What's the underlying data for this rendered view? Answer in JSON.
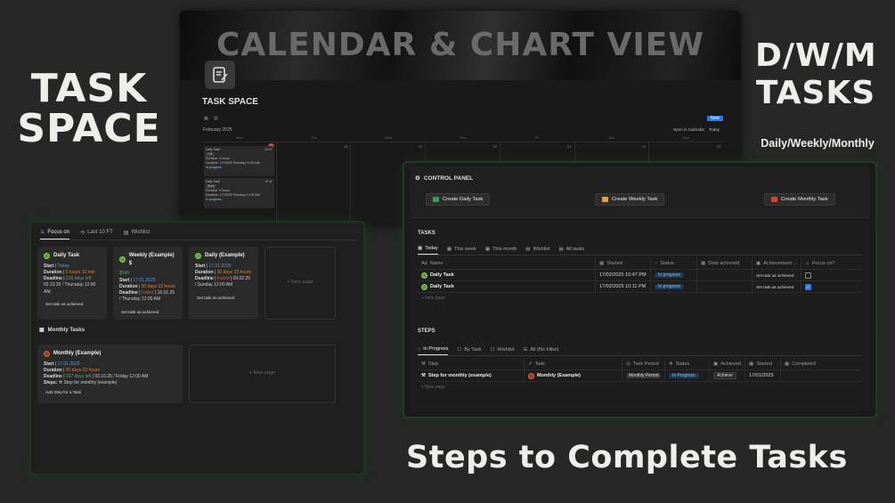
{
  "headlines": {
    "task_space": "TASK SPACE",
    "dwm": "D/W/M TASKS",
    "dwm_sub": "Daily/Weekly/Monthly",
    "steps": "Steps to Complete Tasks"
  },
  "calendar": {
    "cover_title": "CALENDAR & CHART VIEW",
    "page_title": "TASK SPACE",
    "month": "February 2025",
    "open_in_calendar": "Open in Calendar",
    "today_btn": "Today",
    "new_btn": "New",
    "weekdays": [
      "Mon",
      "Tue",
      "Wed",
      "Thu",
      "Fri",
      "Sat",
      "Sun"
    ],
    "days": [
      "17",
      "18",
      "19",
      "20",
      "21",
      "22",
      "23"
    ],
    "cards": [
      {
        "title": "Daily Task",
        "time": "10:47",
        "tag": "Life",
        "duration": "Duration: 9 hours",
        "deadline": "Deadline: 17/02/25 Thursday 12:00 AM",
        "status": "In progress"
      },
      {
        "title": "Daily Task",
        "time": "10:11",
        "tag": "Work",
        "duration": "Duration: 9 hours",
        "deadline": "Deadline: 17/02/25 Thursday 12:00 AM",
        "status": "In progress"
      }
    ]
  },
  "focus": {
    "tabs": [
      "Focus on",
      "Last 10 FT",
      "Wishlist"
    ],
    "cards": [
      {
        "title": "Daily Task",
        "price": "",
        "start_label": "Start",
        "start": "Today",
        "duration_label": "Duration",
        "duration": "9 hours 10 min",
        "deadline_label": "Deadline",
        "deadline_left": "226 days left",
        "deadline_date": "02.10.25 / Thursday 12:00 AM",
        "action": "Set task as achieved"
      },
      {
        "title": "Weekly (Example) $",
        "price": "$545",
        "start_label": "Start",
        "start": "17.01.2025",
        "duration_label": "Duration",
        "duration": "30 days 23 hours",
        "deadline_label": "Deadline",
        "deadline_left": "Failed",
        "deadline_date": "16.01.25 / Thursday 12:00 AM",
        "action": "Set task as achieved"
      },
      {
        "title": "Daily (Example)",
        "price": "",
        "start_label": "Start",
        "start": "17.01.2025",
        "duration_label": "Duration",
        "duration": "30 days 23 hours",
        "deadline_label": "Deadline",
        "deadline_left": "Failed",
        "deadline_date": "09.02.25 / Sunday 12:00 AM",
        "action": "Set task as achieved"
      }
    ],
    "new_page": "+ New page",
    "monthly_heading": "Monthly Tasks",
    "monthly_card": {
      "title": "Monthly (Example)",
      "start_label": "Start",
      "start": "17.01.2025",
      "duration_label": "Duration",
      "duration": "30 days 23 hours",
      "deadline_label": "Deadline",
      "deadline_left": "227 days left",
      "deadline_date": "03.10.25 / Friday 12:00 AM",
      "steps_label": "Steps:",
      "steps": "Step for monthly (example)",
      "action": "Add Step for a Task"
    }
  },
  "control": {
    "title": "CONTROL PANEL",
    "buttons": [
      "Create Daily Task",
      "Create Weekly Task",
      "Create Monthly Task"
    ],
    "button_colors": [
      "#3f9b4f",
      "#d9a23a",
      "#c9453d"
    ],
    "tasks_title": "TASKS",
    "tasks_tabs": [
      "Today",
      "This week",
      "This month",
      "Wishlist",
      "All tasks"
    ],
    "tasks_columns": [
      "Name",
      "Started",
      "Status",
      "Date achieved",
      "Achievement ...",
      "Focus on?"
    ],
    "tasks_rows": [
      {
        "name": "Daily Task",
        "started": "17/02/2025 10:47 PM",
        "status": "In progress",
        "achieved": "",
        "action": "Set task as achieved",
        "focus": false
      },
      {
        "name": "Daily Task",
        "started": "17/02/2025 10:11 PM",
        "status": "In progress",
        "achieved": "",
        "action": "Set task as achieved",
        "focus": true
      }
    ],
    "new_page": "+ New page",
    "steps_title": "STEPS",
    "steps_tabs": [
      "In Progress",
      "By Task",
      "Wishlist",
      "All (No Filter)"
    ],
    "steps_columns": [
      "Step",
      "Task",
      "Task Period",
      "Status",
      "Achieved",
      "Started",
      "Completed"
    ],
    "steps_rows": [
      {
        "step": "Step for monthly (example)",
        "task": "Monthly (Example)",
        "period": "Monthly Period",
        "status": "In Progress",
        "achieved": "Achieve",
        "started": "17/01/2025",
        "completed": ""
      }
    ]
  }
}
